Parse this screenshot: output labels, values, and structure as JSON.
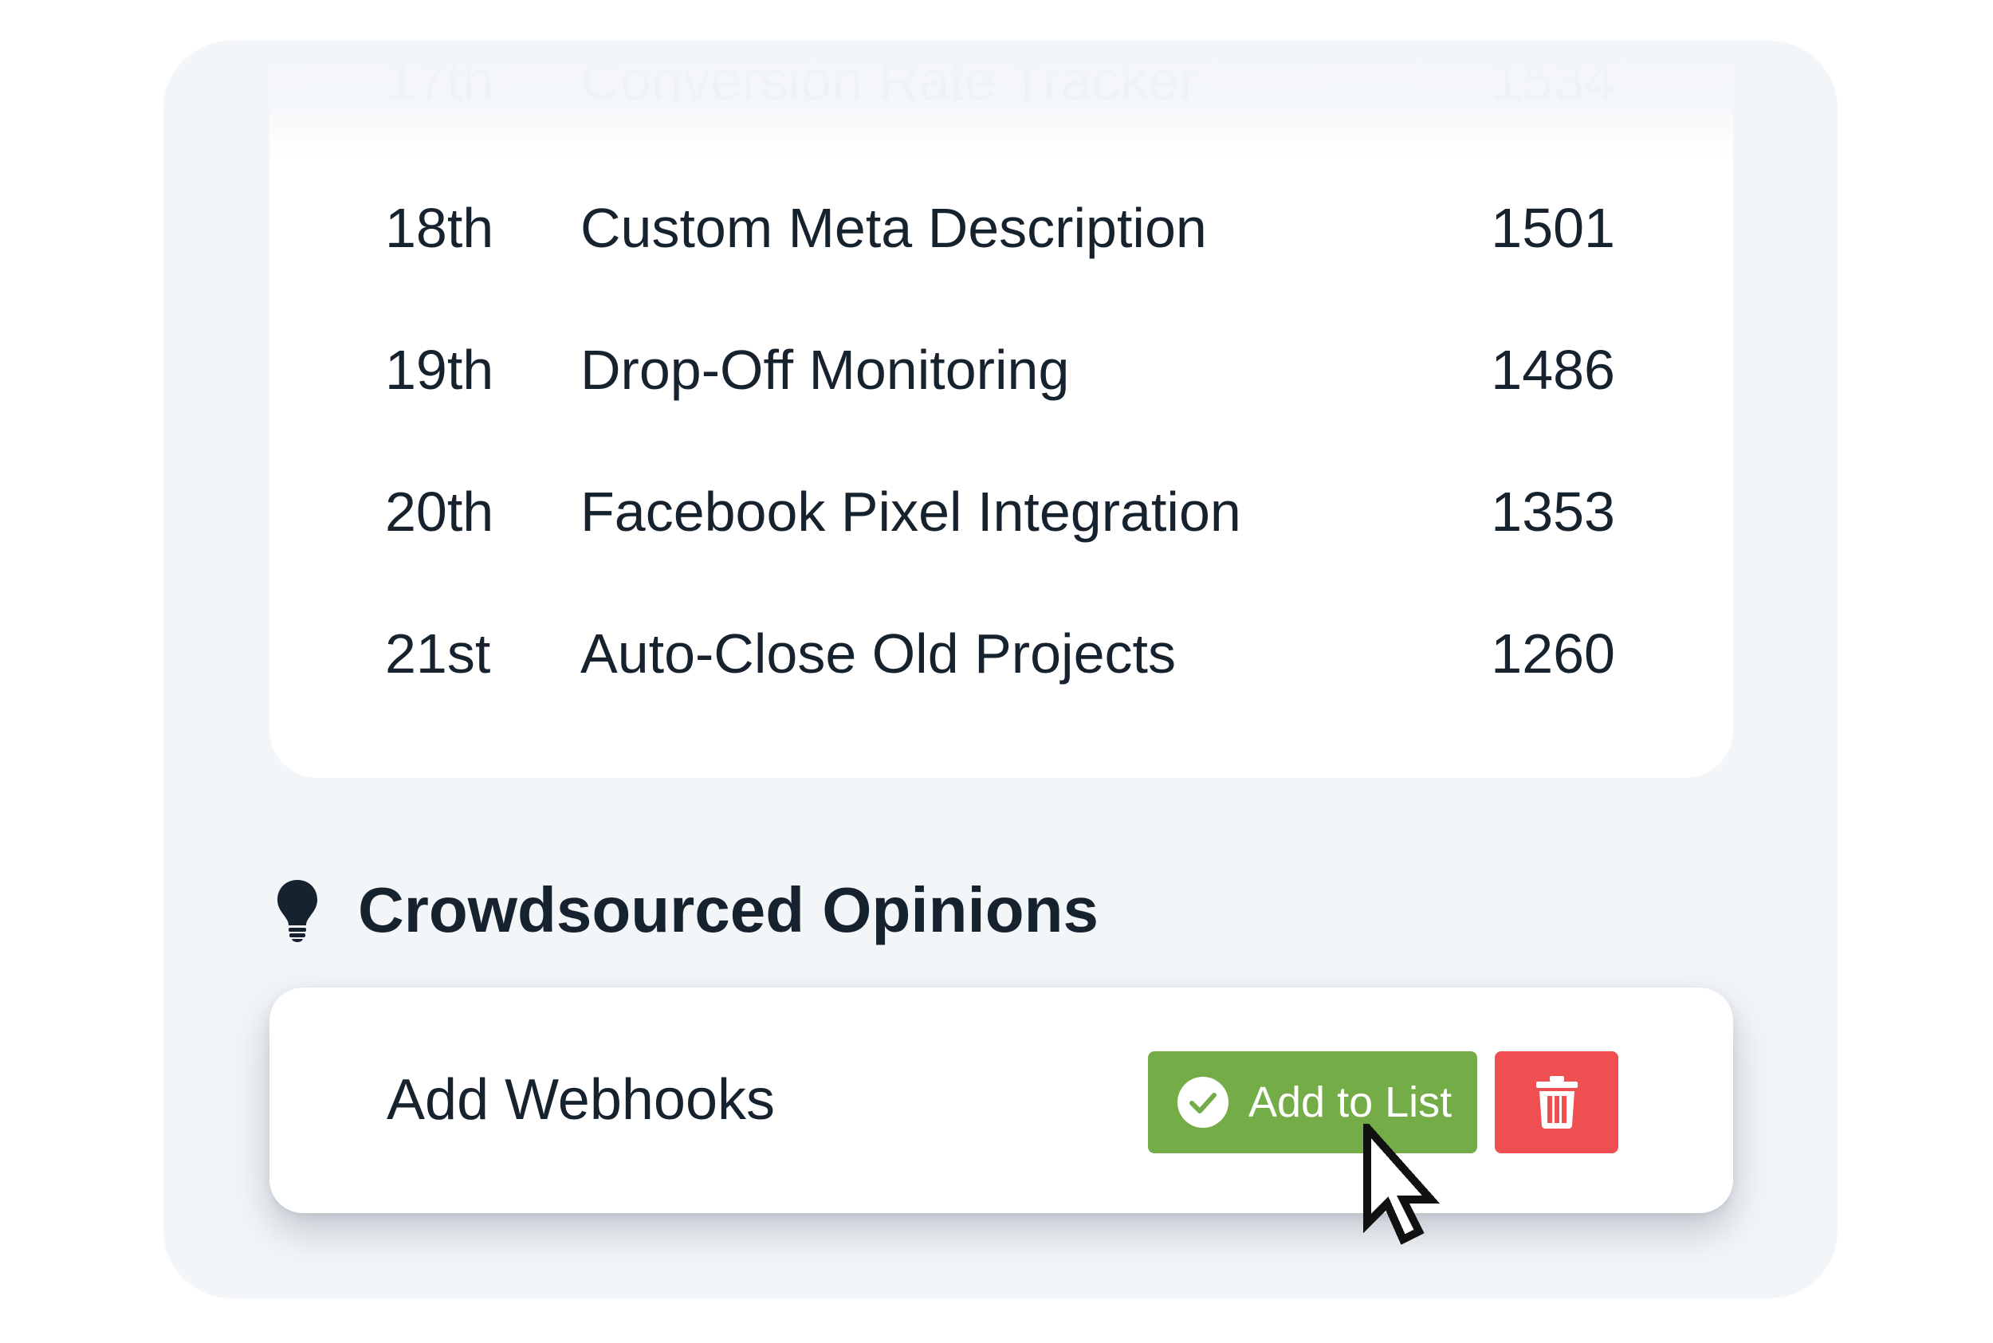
{
  "ranking": {
    "rows": [
      {
        "rank": "17th",
        "name": "Conversion Rate Tracker",
        "count": "1534"
      },
      {
        "rank": "18th",
        "name": "Custom Meta Description",
        "count": "1501"
      },
      {
        "rank": "19th",
        "name": "Drop-Off Monitoring",
        "count": "1486"
      },
      {
        "rank": "20th",
        "name": "Facebook Pixel Integration",
        "count": "1353"
      },
      {
        "rank": "21st",
        "name": "Auto-Close Old Projects",
        "count": "1260"
      }
    ]
  },
  "opinions": {
    "title": "Crowdsourced Opinions",
    "title_icon": "lightbulb-icon",
    "item": {
      "label": "Add Webhooks",
      "add_button_label": "Add to List",
      "add_button_icon": "check-circle-icon",
      "delete_button_icon": "trash-icon"
    }
  },
  "colors": {
    "panel_bg": "#f3f6f9",
    "text": "#16222e",
    "add_green": "#74ad47",
    "delete_red": "#f04f51"
  }
}
